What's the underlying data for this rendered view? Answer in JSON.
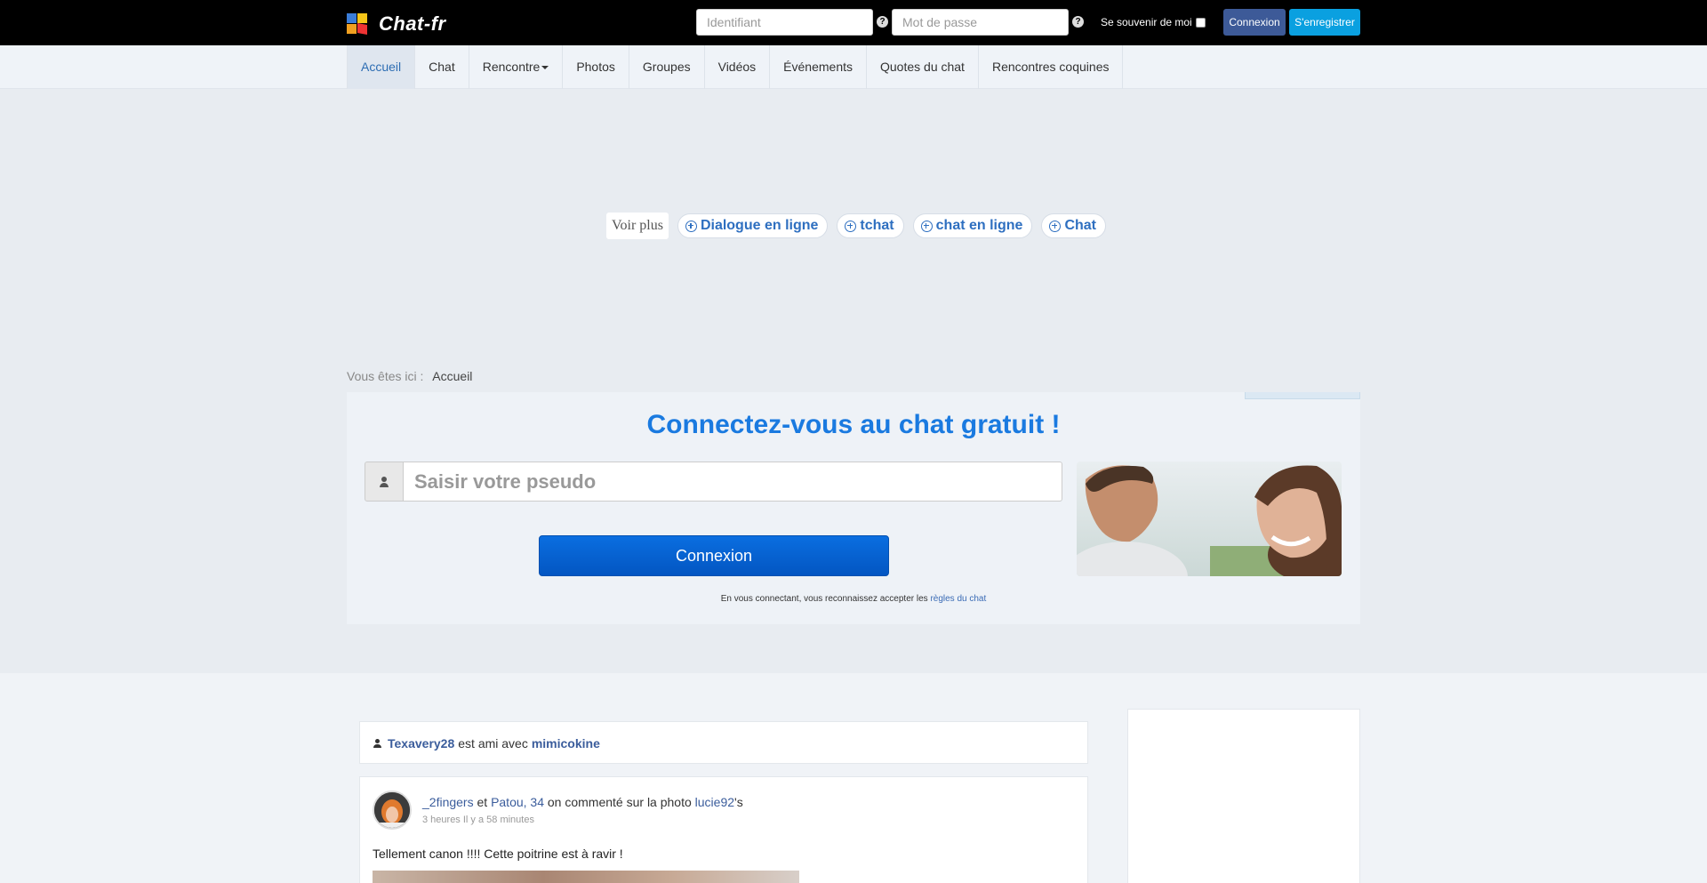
{
  "header": {
    "logo_text": "Chat-fr",
    "username_placeholder": "Identifiant",
    "password_placeholder": "Mot de passe",
    "help_glyph": "?",
    "remember_label": "Se souvenir de moi",
    "login_button": "Connexion",
    "register_button": "S'enregistrer",
    "colors": {
      "login": "#3d5a98",
      "register": "#0aa0e0"
    }
  },
  "nav": {
    "items": [
      {
        "label": "Accueil",
        "active": true
      },
      {
        "label": "Chat"
      },
      {
        "label": "Rencontre",
        "dropdown": true
      },
      {
        "label": "Photos"
      },
      {
        "label": "Groupes"
      },
      {
        "label": "Vidéos"
      },
      {
        "label": "Événements"
      },
      {
        "label": "Quotes du chat"
      },
      {
        "label": "Rencontres coquines"
      }
    ]
  },
  "ads": {
    "voir_plus": "Voir plus",
    "chips": [
      "Dialogue en ligne",
      "tchat",
      "chat en ligne",
      "Chat"
    ]
  },
  "breadcrumb": {
    "label": "Vous êtes ici :",
    "current": "Accueil"
  },
  "login_panel": {
    "title": "Connectez-vous au chat gratuit !",
    "pseudo_placeholder": "Saisir votre pseudo",
    "button": "Connexion",
    "terms_prefix": "En vous connectant, vous reconnaissez accepter les",
    "terms_link": "règles du chat",
    "title_color": "#1a7ae0"
  },
  "feed": {
    "notice": {
      "user1": "Texavery28",
      "connector": "est ami avec",
      "user2": "mimicokine"
    },
    "post": {
      "user1": "_2fingers",
      "and": "et",
      "user2": "Patou, 34",
      "action": "on commenté sur la photo",
      "owner": "lucie92",
      "owner_suffix": "'s",
      "time": "3 heures Il y a 58 minutes",
      "text": "Tellement canon !!!! Cette poitrine est à ravir !"
    }
  }
}
